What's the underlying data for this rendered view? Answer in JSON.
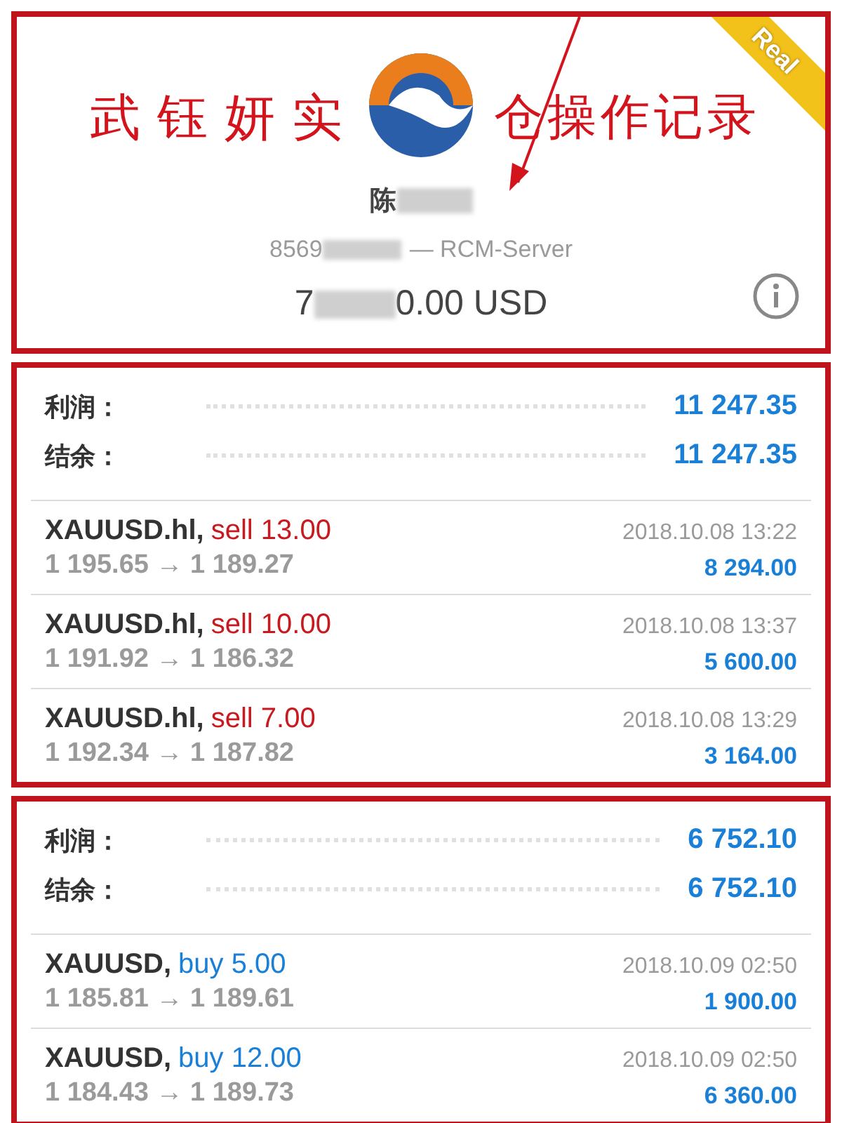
{
  "account": {
    "annotation": [
      "武钰妍实",
      "仓操作记录"
    ],
    "badge": "Real",
    "name": "陈",
    "number": "8569",
    "server": "— RCM-Server",
    "balance_start": "7",
    "balance_end": "0.00 USD"
  },
  "groups": [
    {
      "summary": [
        {
          "label": "利润：",
          "value": "11 247.35"
        },
        {
          "label": "结余：",
          "value": "11 247.35"
        }
      ],
      "trades": [
        {
          "symbol": "XAUUSD.hl,",
          "type": "sell",
          "volume": "13.00",
          "prices": "1 195.65 → 1 189.27",
          "time": "2018.10.08 13:22",
          "profit": "8 294.00"
        },
        {
          "symbol": "XAUUSD.hl,",
          "type": "sell",
          "volume": "10.00",
          "prices": "1 191.92 → 1 186.32",
          "time": "2018.10.08 13:37",
          "profit": "5 600.00"
        },
        {
          "symbol": "XAUUSD.hl,",
          "type": "sell",
          "volume": "7.00",
          "prices": "1 192.34 → 1 187.82",
          "time": "2018.10.08 13:29",
          "profit": "3 164.00"
        }
      ]
    },
    {
      "summary": [
        {
          "label": "利润：",
          "value": "6 752.10"
        },
        {
          "label": "结余：",
          "value": "6 752.10"
        }
      ],
      "trades": [
        {
          "symbol": "XAUUSD,",
          "type": "buy",
          "volume": "5.00",
          "prices": "1 185.81 → 1 189.61",
          "time": "2018.10.09 02:50",
          "profit": "1 900.00"
        },
        {
          "symbol": "XAUUSD,",
          "type": "buy",
          "volume": "12.00",
          "prices": "1 184.43 → 1 189.73",
          "time": "2018.10.09 02:50",
          "profit": "6 360.00"
        }
      ]
    }
  ]
}
